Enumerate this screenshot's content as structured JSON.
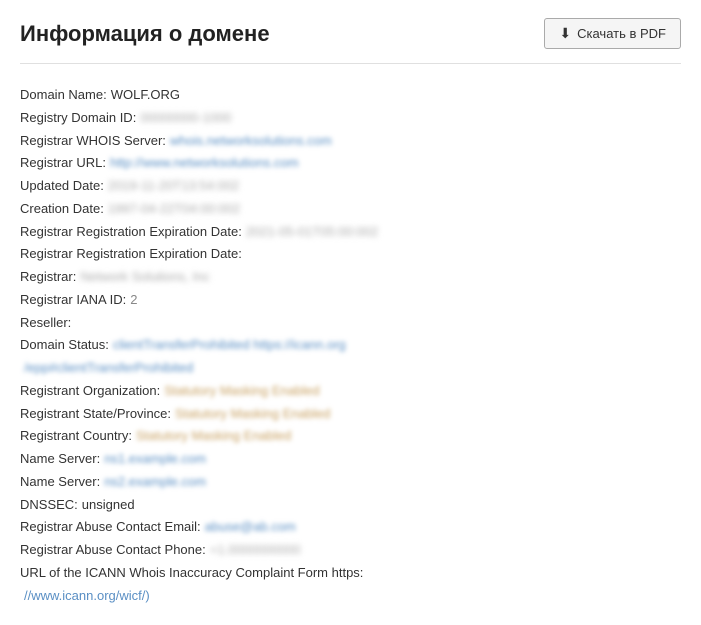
{
  "header": {
    "title": "Информация о домене",
    "download_button": "Скачать в PDF"
  },
  "whois": {
    "domain_name_label": "Domain Name:",
    "domain_name_value": "WOLF.ORG",
    "registry_id_label": "Registry Domain ID:",
    "registry_id_value": "00000000-1000",
    "registrar_whois_label": "Registrar WHOIS Server:",
    "registrar_whois_value": "whois.networksolutions.com",
    "registrar_url_label": "Registrar URL:",
    "registrar_url_value": "http://www.networksolutions.com",
    "updated_label": "Updated Date:",
    "updated_value": "2019-11-20T13:54:002",
    "creation_label": "Creation Date:",
    "creation_value": "1997-04-22T04:00:002",
    "expiration1_label": "Registrar Registration Expiration Date:",
    "expiration1_value": "2021-05-01T05:00:002",
    "expiration2_label": "Registrar Registration Expiration Date:",
    "expiration2_value": "",
    "registrar_label": "Registrar:",
    "registrar_value": "Network Solutions, Inc",
    "iana_label": "Registrar IANA ID:",
    "iana_value": "2",
    "reseller_label": "Reseller:",
    "reseller_value": "",
    "domain_status_label": "Domain Status:",
    "domain_status_value": "clientTransferProhibited https://icann.org",
    "domain_status_value2": "/epp#clientTransferProhibited",
    "registrant_org_label": "Registrant Organization:",
    "registrant_org_value": "Statutory Masking Enabled",
    "registrant_state_label": "Registrant State/Province:",
    "registrant_state_value": "Statutory Masking Enabled",
    "registrant_country_label": "Registrant Country:",
    "registrant_country_value": "Statutory Masking Enabled",
    "ns1_label": "Name Server:",
    "ns1_value": "ns1.example.com",
    "ns2_label": "Name Server:",
    "ns2_value": "ns2.example.com",
    "dnssec_label": "DNSSEC:",
    "dnssec_value": "unsigned",
    "abuse_email_label": "Registrar Abuse Contact Email:",
    "abuse_email_value": "abuse@ab.com",
    "abuse_phone_label": "Registrar Abuse Contact Phone:",
    "abuse_phone_value": "+1.0000000000",
    "icann_label": "URL of the ICANN Whois Inaccuracy Complaint Form https:",
    "icann_value": "//www.icann.org/wicf/)"
  }
}
